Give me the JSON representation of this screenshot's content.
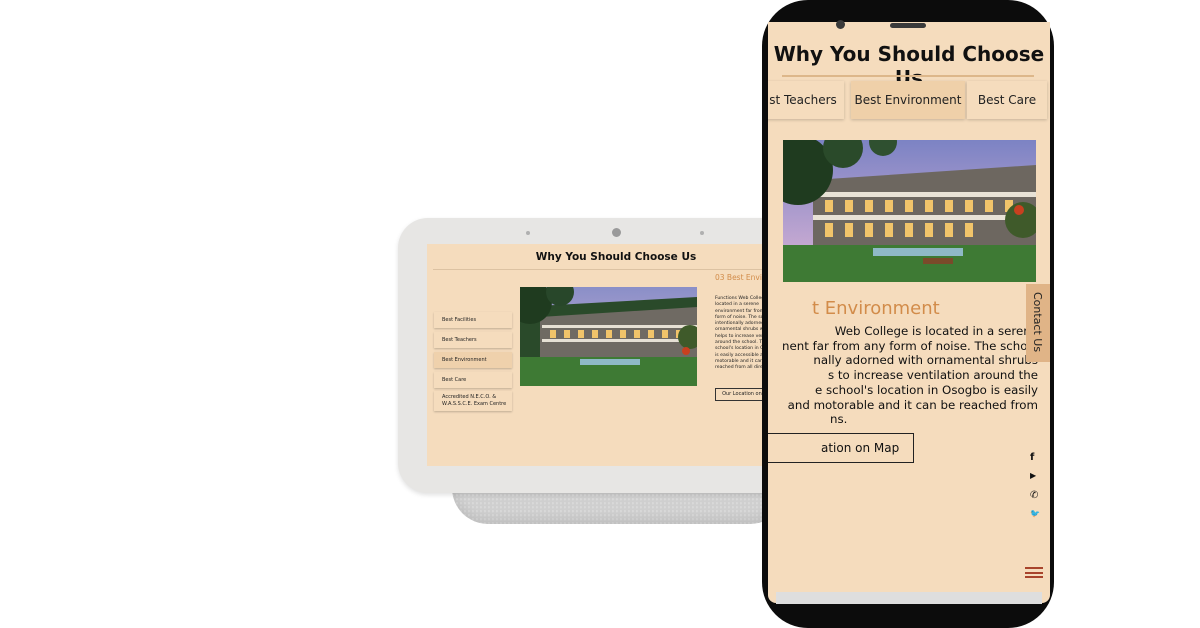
{
  "title": "Why You Should Choose Us",
  "tabs": [
    {
      "label": "Best Facilities"
    },
    {
      "label": "Best Teachers"
    },
    {
      "label": "Best Environment"
    },
    {
      "label": "Best Care"
    },
    {
      "label": "Accredited N.E.C.O. & W.A.S.S.C.E. Exam Centre"
    }
  ],
  "phone_tabs": [
    "st Teachers",
    "Best Environment",
    "Best Care"
  ],
  "section": {
    "heading": "03 Best Environment",
    "phone_heading": "t Environment",
    "body_lines": [
      "Functions Web College is",
      "located in a serene",
      "environment far from any",
      "form of noise. The school is",
      "intentionally adorned with",
      "ornamental shrubs which",
      "helps to increase ventilation",
      "around the school. The",
      "school's location in Osogbo",
      "is easily accessible and",
      "motorable and it can be",
      "reached from all directions."
    ],
    "phone_body_lines": [
      "Web College is located in a serene",
      "nent far from any form of noise. The school",
      "nally adorned with ornamental shrubs",
      "s to increase ventilation around the",
      "e school's location in Osogbo is easily",
      "and motorable and it can be reached from",
      "ns."
    ],
    "button_label": "Our Location on Map",
    "phone_button_label": "ation on Map"
  },
  "contact_label": "Contact Us",
  "social_icons": [
    "facebook-icon",
    "youtube-icon",
    "whatsapp-icon",
    "twitter-icon"
  ],
  "social_glyphs": {
    "facebook": "f",
    "youtube": "▶",
    "whatsapp": "✆",
    "twitter": "🐦"
  },
  "colors": {
    "background": "#f5dcbd",
    "accent": "#d28c4a",
    "contact_tab": "#e0b487",
    "menu": "#a8442c"
  }
}
